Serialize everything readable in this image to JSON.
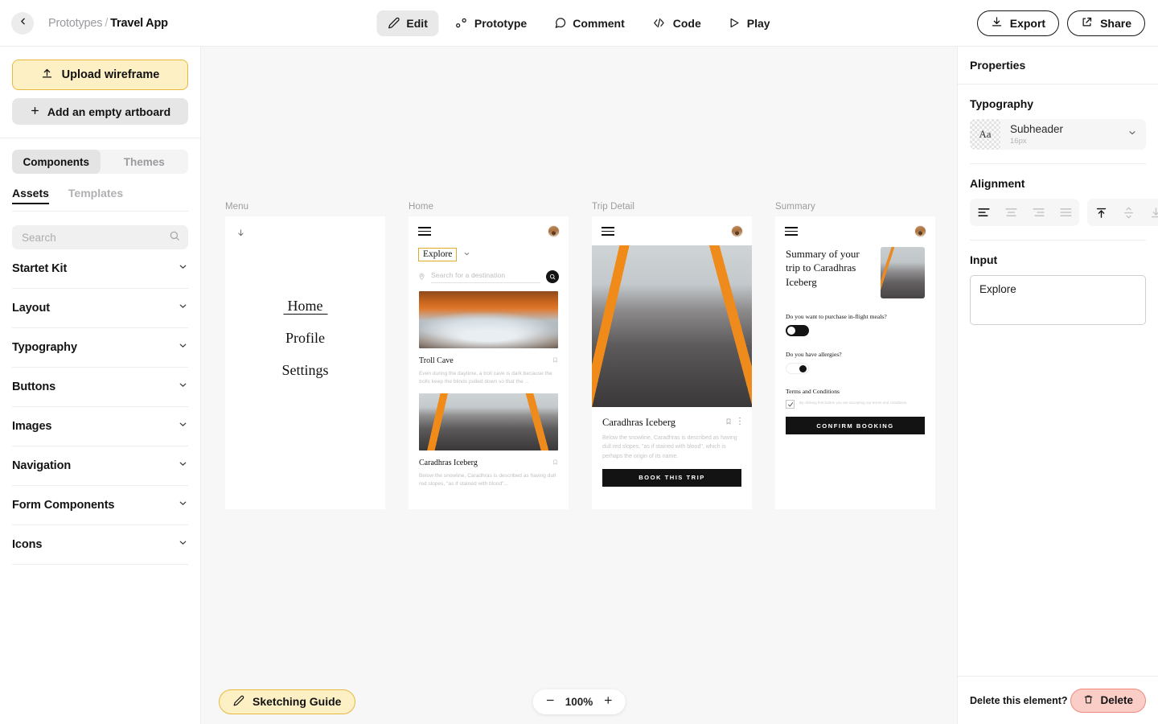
{
  "topbar": {
    "back_icon": "chevron-left-icon",
    "breadcrumb_parent": "Prototypes",
    "breadcrumb_sep": "/",
    "breadcrumb_current": "Travel App",
    "tabs": [
      {
        "label": "Edit",
        "icon": "pencil-icon",
        "active": true
      },
      {
        "label": "Prototype",
        "icon": "prototype-nodes-icon",
        "active": false
      },
      {
        "label": "Comment",
        "icon": "comment-bubble-icon",
        "active": false
      },
      {
        "label": "Code",
        "icon": "code-brackets-icon",
        "active": false
      },
      {
        "label": "Play",
        "icon": "play-triangle-icon",
        "active": false
      }
    ],
    "export_label": "Export",
    "export_icon": "download-icon",
    "share_label": "Share",
    "share_icon": "external-link-icon"
  },
  "sidebar": {
    "upload_label": "Upload wireframe",
    "upload_icon": "upload-icon",
    "add_artboard_label": "Add an empty artboard",
    "add_artboard_icon": "plus-icon",
    "segments": [
      {
        "label": "Components",
        "active": true
      },
      {
        "label": "Themes",
        "active": false
      }
    ],
    "subtabs": [
      {
        "label": "Assets",
        "active": true
      },
      {
        "label": "Templates",
        "active": false
      }
    ],
    "search_placeholder": "Search",
    "search_value": "",
    "search_icon": "search-icon",
    "accordions": [
      {
        "label": "Startet Kit"
      },
      {
        "label": "Layout"
      },
      {
        "label": "Typography"
      },
      {
        "label": "Buttons"
      },
      {
        "label": "Images"
      },
      {
        "label": "Navigation"
      },
      {
        "label": "Form Components"
      },
      {
        "label": "Icons"
      }
    ]
  },
  "canvas": {
    "background": "#f7f7f7",
    "boards": [
      {
        "label": "Menu",
        "arrow_icon": "arrow-down-icon",
        "items": [
          {
            "label": "Home",
            "selected": true
          },
          {
            "label": "Profile",
            "selected": false
          },
          {
            "label": "Settings",
            "selected": false
          }
        ]
      },
      {
        "label": "Home",
        "menu_icon": "hamburger-icon",
        "avatar_icon": "avatar",
        "explore_label": "Explore",
        "explore_caret_icon": "chevron-down-icon",
        "location_icon": "location-pin-icon",
        "search_placeholder": "Search for a destination",
        "search_button_icon": "search-icon",
        "cards": [
          {
            "title": "Troll Cave",
            "desc": "Even during the daytime, a troll cave is dark because the trolls keep the blinds pulled down so that the ...",
            "bookmark_icon": "bookmark-icon"
          },
          {
            "title": "Caradhras Iceberg",
            "desc": "Below the snowline, Caradhras is described as having dull red slopes, \"as if stained with blood\"...",
            "bookmark_icon": "bookmark-icon"
          }
        ]
      },
      {
        "label": "Trip Detail",
        "menu_icon": "hamburger-icon",
        "avatar_icon": "avatar",
        "title": "Caradhras Iceberg",
        "bookmark_icon": "bookmark-icon",
        "more_icon": "more-vertical-icon",
        "desc": "Below the snowline, Caradhras is described as having dull red slopes, \"as if stained with blood\", which is perhaps the origin of its name.",
        "cta_label": "BOOK THIS TRIP"
      },
      {
        "label": "Summary",
        "menu_icon": "hamburger-icon",
        "avatar_icon": "avatar",
        "title": "Summary of your trip to Caradhras Iceberg",
        "question_meals": "Do you want to purchase in-flight meals?",
        "toggle_meals_state": "off",
        "question_allergies": "Do you have allergies?",
        "toggle_allergies_state": "on",
        "terms_title": "Terms and Conditions",
        "terms_text": "By clicking this button you are accepting our terms and conditions.",
        "terms_checked": true,
        "cta_label": "CONFIRM BOOKING"
      }
    ],
    "bottom": {
      "sketching_label": "Sketching Guide",
      "sketching_icon": "pencil-icon",
      "zoom_out_icon": "minus-icon",
      "zoom_value": "100%",
      "zoom_in_icon": "plus-icon"
    }
  },
  "properties": {
    "title": "Properties",
    "typography": {
      "section_title": "Typography",
      "swatch_label": "Aa",
      "style_name": "Subheader",
      "style_size": "16px",
      "caret_icon": "chevron-down-icon"
    },
    "alignment": {
      "section_title": "Alignment",
      "horizontal": [
        {
          "name": "align-left-icon",
          "active": true
        },
        {
          "name": "align-center-icon",
          "active": false
        },
        {
          "name": "align-right-icon",
          "active": false
        },
        {
          "name": "align-justify-icon",
          "active": false
        }
      ],
      "vertical": [
        {
          "name": "align-top-icon",
          "active": true
        },
        {
          "name": "align-middle-icon",
          "active": false
        },
        {
          "name": "align-bottom-icon",
          "active": false
        }
      ]
    },
    "input": {
      "section_title": "Input",
      "value": "Explore",
      "placeholder": ""
    },
    "footer": {
      "delete_prompt": "Delete this element?",
      "delete_label": "Delete",
      "delete_icon": "trash-icon",
      "delete_color": "#fbcdc7"
    }
  },
  "theme": {
    "accent_yellow": "#fdf0c4",
    "accent_yellow_border": "#e8b93e",
    "danger": "#fbcdc7",
    "dark": "#131313"
  }
}
